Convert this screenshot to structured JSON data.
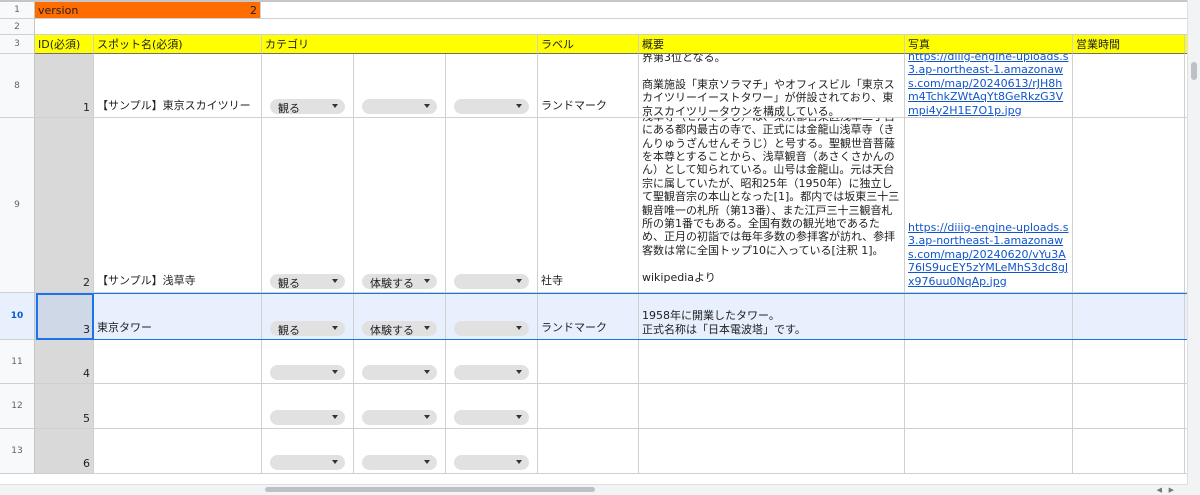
{
  "version_row": {
    "label": "version",
    "value": "2"
  },
  "headers": {
    "id": "ID(必須)",
    "spot": "スポット名(必須)",
    "category": "カテゴリ",
    "label": "ラベル",
    "summary": "概要",
    "photo": "写真",
    "hours": "営業時間"
  },
  "row_numbers": [
    "1",
    "2",
    "3",
    "8",
    "9",
    "10",
    "11",
    "12",
    "13"
  ],
  "rows": [
    {
      "id": "1",
      "name": "【サンプル】東京スカイツリー",
      "cat1": "観る",
      "cat2": "",
      "cat3": "",
      "label": "ランドマーク",
      "summary": "界第3位となる。\n\n商業施設「東京ソラマチ」やオフィスビル「東京スカイツリーイーストタワー」が併設されており、東京スカイツリータウンを構成している。",
      "photo": "https://diiig-engine-uploads.s3.ap-northeast-1.amazonaws.com/map/20240613/rJH8hm4TchkZWtAqYt8GeRkzG3Vmpi4y2H1E7O1p.jpg"
    },
    {
      "id": "2",
      "name": "【サンプル】浅草寺",
      "cat1": "観る",
      "cat2": "体験する",
      "cat3": "",
      "label": "社寺",
      "summary": "浅草寺（せんそうじ）は、東京都台東区浅草二丁目にある都内最古の寺で、正式には金龍山浅草寺（きんりゅうざんせんそうじ）と号する。聖観世音菩薩を本尊とすることから、浅草観音（あさくさかんのん）として知られている。山号は金龍山。元は天台宗に属していたが、昭和25年（1950年）に独立して聖観音宗の本山となった[1]。都内では坂東三十三観音唯一の札所（第13番）、また江戸三十三観音札所の第1番でもある。全国有数の観光地であるため、正月の初詣では毎年多数の参拝客が訪れ、参拝客数は常に全国トップ10に入っている[注釈 1]。\n\nwikipediaより",
      "photo": "https://diiig-engine-uploads.s3.ap-northeast-1.amazonaws.com/map/20240620/vYu3A76lS9ucEY5zYMLeMhS3dc8gJx976uu0NqAp.jpg"
    },
    {
      "id": "3",
      "name": "東京タワー",
      "cat1": "観る",
      "cat2": "体験する",
      "cat3": "",
      "label": "ランドマーク",
      "summary": "1958年に開業したタワー。\n正式名称は「日本電波塔」です。",
      "photo": ""
    },
    {
      "id": "4",
      "name": "",
      "cat1": "",
      "cat2": "",
      "cat3": "",
      "label": "",
      "summary": "",
      "photo": ""
    },
    {
      "id": "5",
      "name": "",
      "cat1": "",
      "cat2": "",
      "cat3": "",
      "label": "",
      "summary": "",
      "photo": ""
    },
    {
      "id": "6",
      "name": "",
      "cat1": "",
      "cat2": "",
      "cat3": "",
      "label": "",
      "summary": "",
      "photo": ""
    }
  ],
  "colors": {
    "header_fill": "#ffff00",
    "version_fill": "#ff6d01",
    "id_fill": "#d9d9d9",
    "selection": "#1a73e8",
    "link": "#1155cc"
  },
  "icons": [
    "dropdown-arrow-icon"
  ]
}
